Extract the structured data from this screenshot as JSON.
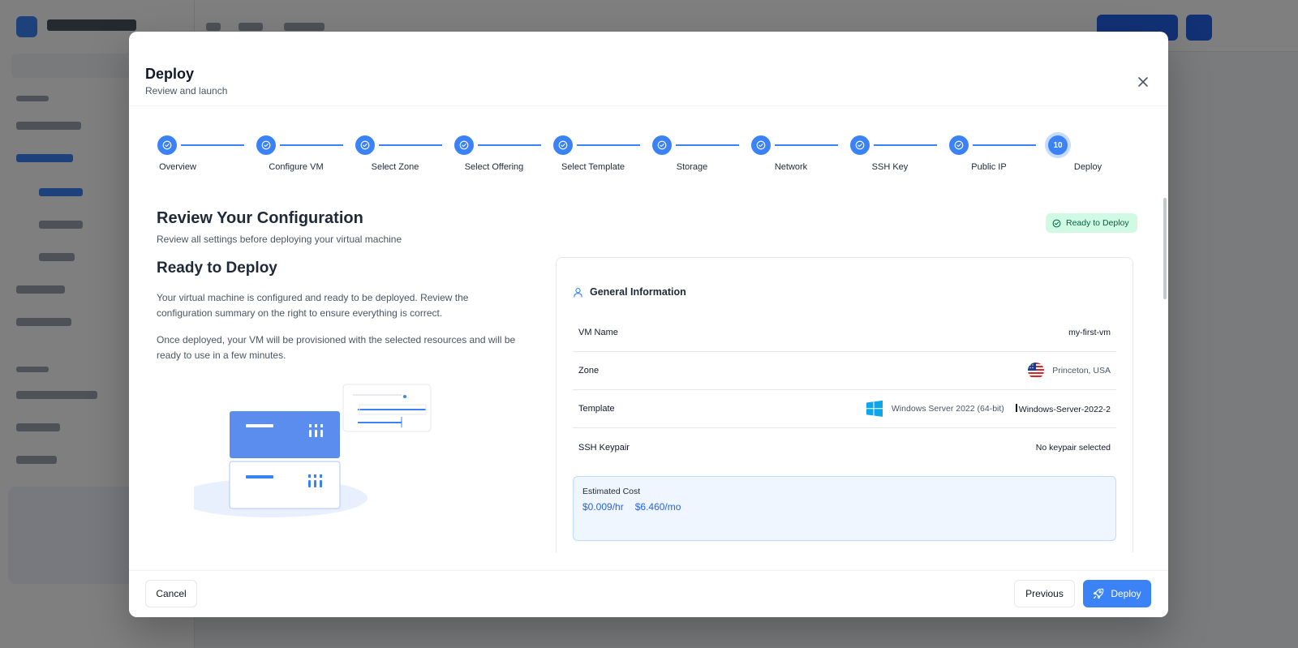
{
  "modal": {
    "title": "Deploy",
    "subtitle": "Review and launch"
  },
  "stepper": {
    "current_step_number": "10",
    "steps": [
      {
        "label": "Overview",
        "status": "complete"
      },
      {
        "label": "Configure VM",
        "status": "complete"
      },
      {
        "label": "Select Zone",
        "status": "complete"
      },
      {
        "label": "Select Offering",
        "status": "complete"
      },
      {
        "label": "Select Template",
        "status": "complete"
      },
      {
        "label": "Storage",
        "status": "complete"
      },
      {
        "label": "Network",
        "status": "complete"
      },
      {
        "label": "SSH Key",
        "status": "complete"
      },
      {
        "label": "Public IP",
        "status": "complete"
      },
      {
        "label": "Deploy",
        "status": "current"
      }
    ]
  },
  "review": {
    "title": "Review Your Configuration",
    "subtitle": "Review all settings before deploying your virtual machine",
    "status_badge": "Ready to Deploy"
  },
  "ready": {
    "title": "Ready to Deploy",
    "paragraph1": "Your virtual machine is configured and ready to be deployed. Review the configuration summary on the right to ensure everything is correct.",
    "paragraph2": "Once deployed, your VM will be provisioned with the selected resources and will be ready to use in a few minutes."
  },
  "general_info": {
    "title": "General Information",
    "vm_name_label": "VM Name",
    "vm_name_value": "my-first-vm",
    "zone_label": "Zone",
    "zone_value": "Princeton, USA",
    "template_label": "Template",
    "template_name": "Windows Server 2022 (64-bit)",
    "template_id": "Windows-Server-2022-2",
    "ssh_label": "SSH Keypair",
    "ssh_value": "No keypair selected"
  },
  "cost": {
    "label": "Estimated Cost",
    "hourly": "$0.009/hr",
    "monthly": "$6.460/mo"
  },
  "footer": {
    "cancel_label": "Cancel",
    "previous_label": "Previous",
    "deploy_label": "Deploy"
  },
  "colors": {
    "accent": "#3b82f6",
    "success_bg": "#d1fae5",
    "success_text": "#065f46"
  }
}
